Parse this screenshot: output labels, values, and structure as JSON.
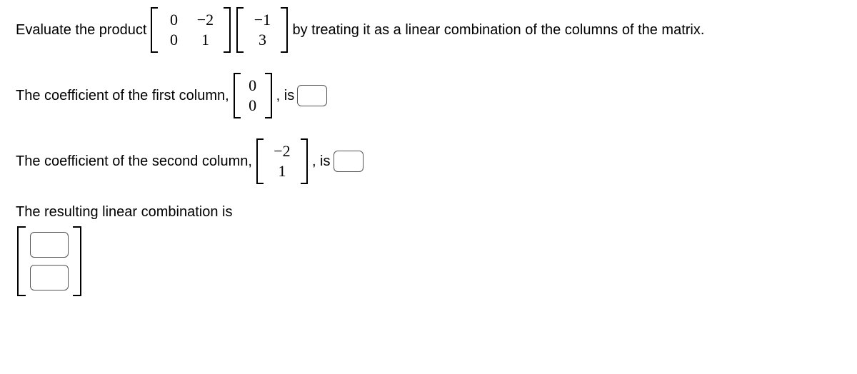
{
  "problem": {
    "prefix": "Evaluate the product",
    "matrixA": [
      [
        "0",
        "−2"
      ],
      [
        "0",
        "1"
      ]
    ],
    "vectorB": [
      [
        "−1"
      ],
      [
        "3"
      ]
    ],
    "suffix": "by treating it as a linear combination of the columns of the matrix."
  },
  "part1": {
    "prefix": "The coefficient of the first column,",
    "column": [
      [
        "0"
      ],
      [
        "0"
      ]
    ],
    "mid": ", is"
  },
  "part2": {
    "prefix": "The coefficient of the second column,",
    "column": [
      [
        "−2"
      ],
      [
        "1"
      ]
    ],
    "mid": ", is"
  },
  "part3": {
    "text": "The resulting linear combination is"
  }
}
